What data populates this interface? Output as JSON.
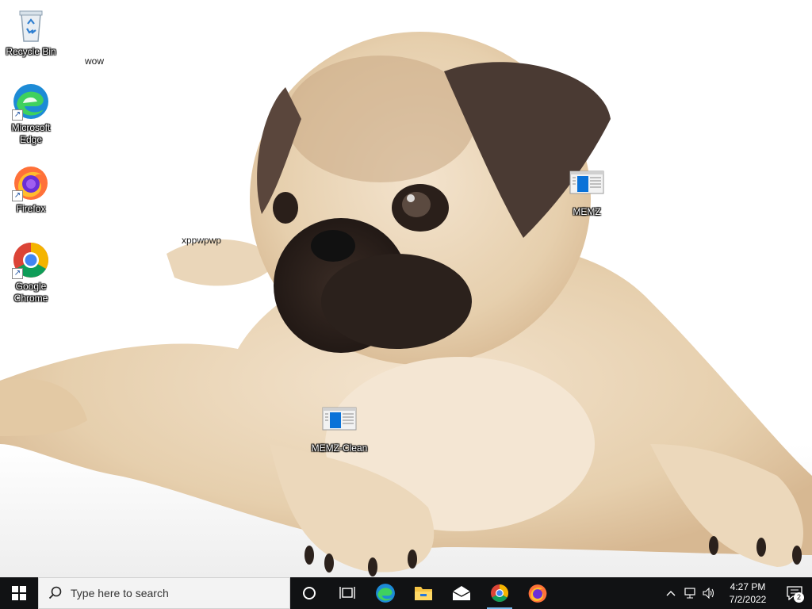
{
  "desktop": {
    "icons": [
      {
        "label": "Recycle Bin",
        "icon": "recycle-bin-icon"
      },
      {
        "label": "Microsoft Edge",
        "icon": "edge-icon"
      },
      {
        "label": "Firefox",
        "icon": "firefox-icon"
      },
      {
        "label": "Google Chrome",
        "icon": "chrome-icon"
      },
      {
        "label": "MEMZ",
        "icon": "memz-app-icon"
      },
      {
        "label": "MEMZ-Clean",
        "icon": "memz-app-icon"
      }
    ],
    "edge_label_line1": "Microsoft",
    "edge_label_line2": "Edge",
    "chrome_label_line1": "Google",
    "chrome_label_line2": "Chrome",
    "texts": [
      "wow",
      "xppwpwp"
    ]
  },
  "taskbar": {
    "start_icon": "windows-start-icon",
    "search_placeholder": "Type here to search",
    "pinned": [
      {
        "name": "cortana",
        "icon": "cortana-circle-icon"
      },
      {
        "name": "task-view",
        "icon": "task-view-icon"
      },
      {
        "name": "edge",
        "icon": "edge-icon"
      },
      {
        "name": "file-explorer",
        "icon": "folder-icon"
      },
      {
        "name": "mail",
        "icon": "mail-icon"
      },
      {
        "name": "chrome",
        "icon": "chrome-icon"
      },
      {
        "name": "firefox",
        "icon": "firefox-icon"
      }
    ],
    "tray": {
      "time": "4:27 PM",
      "date": "7/2/2022",
      "notification_count": "2"
    }
  },
  "colors": {
    "taskbar_bg": "#111214",
    "accent": "#0078d7",
    "active_underline": "#76b9ed"
  }
}
